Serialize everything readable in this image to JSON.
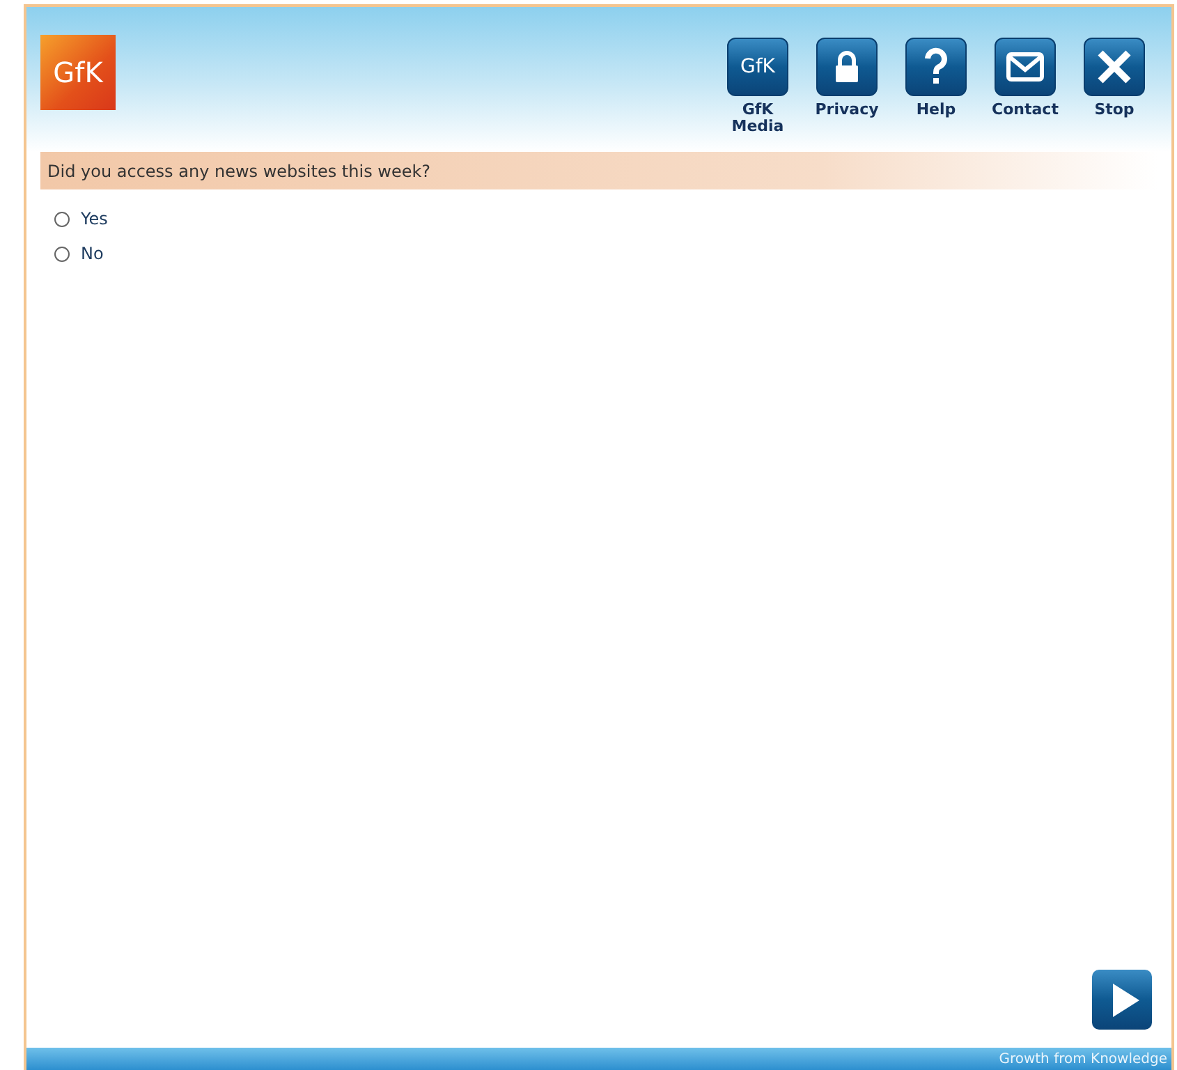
{
  "logo": {
    "text": "GfK"
  },
  "toolbar": [
    {
      "kind": "text",
      "glyph": "GfK",
      "label": "GfK Media"
    },
    {
      "kind": "lock",
      "label": "Privacy"
    },
    {
      "kind": "question",
      "label": "Help"
    },
    {
      "kind": "mail",
      "label": "Contact"
    },
    {
      "kind": "close",
      "label": "Stop"
    }
  ],
  "question": "Did you access any news websites this week?",
  "options": [
    {
      "label": "Yes",
      "selected": false
    },
    {
      "label": "No",
      "selected": false
    }
  ],
  "next_button": {
    "kind": "play"
  },
  "footer": "Growth from Knowledge"
}
